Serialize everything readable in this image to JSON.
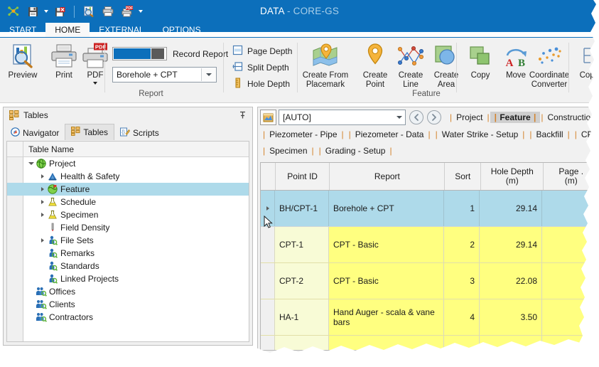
{
  "window": {
    "title_main": "DATA",
    "title_sep": " - ",
    "title_sub": "CORE-GS"
  },
  "quick_access": [
    {
      "name": "core-gs-logo-icon",
      "label": "CORE-GS"
    },
    {
      "name": "save-icon",
      "label": "Save"
    },
    {
      "name": "save-dropdown-caret-icon",
      "label": "Save options"
    },
    {
      "name": "save-close-icon",
      "label": "Save and Close"
    },
    {
      "name": "print-preview-icon",
      "label": "Print Preview"
    },
    {
      "name": "print-icon",
      "label": "Print"
    },
    {
      "name": "pdf-icon",
      "label": "PDF"
    },
    {
      "name": "pdf-dropdown-caret-icon",
      "label": "PDF options"
    }
  ],
  "ribbon_tabs": [
    {
      "label": "START",
      "active": false
    },
    {
      "label": "HOME",
      "active": true
    },
    {
      "label": "EXTERNAL",
      "active": false
    },
    {
      "label": "OPTIONS",
      "active": false
    }
  ],
  "ribbon": {
    "report_group": {
      "label": "Report",
      "preview": "Preview",
      "print": "Print",
      "pdf": "PDF",
      "record_report_label": "Record Report",
      "report_combo_value": "Borehole + CPT",
      "page_depth": "Page Depth",
      "split_depth": "Split Depth",
      "hole_depth": "Hole Depth"
    },
    "feature_group": {
      "label": "Feature",
      "create_from_placemark": "Create From\nPlacemark",
      "create_from_placemark_l1": "Create From",
      "create_from_placemark_l2": "Placemark",
      "create_point_l1": "Create",
      "create_point_l2": "Point",
      "create_line_l1": "Create",
      "create_line_l2": "Line",
      "create_area_l1": "Create",
      "create_area_l2": "Area",
      "copy": "Copy",
      "move": "Move",
      "coordinate_converter_l1": "Coordinate",
      "coordinate_converter_l2": "Converter"
    },
    "partial_group": {
      "copy_label": "Copy"
    }
  },
  "left_panel": {
    "header_title": "Tables",
    "pin_glyph": "∓",
    "tabs": [
      {
        "label": "Navigator",
        "icon": "compass-icon",
        "active": false
      },
      {
        "label": "Tables",
        "icon": "tables-icon",
        "active": true
      },
      {
        "label": "Scripts",
        "icon": "scripts-icon",
        "active": false
      }
    ],
    "column_header": "Table Name",
    "tree": [
      {
        "label": "Project",
        "indent": 0,
        "expander": "down",
        "icon": "globe-icon",
        "selected": false
      },
      {
        "label": "Health & Safety",
        "indent": 1,
        "expander": "right",
        "icon": "hardhat-icon",
        "selected": false
      },
      {
        "label": "Feature",
        "indent": 1,
        "expander": "right",
        "icon": "globe-flag-icon",
        "selected": true
      },
      {
        "label": "Schedule",
        "indent": 1,
        "expander": "right",
        "icon": "flask-icon",
        "selected": false
      },
      {
        "label": "Specimen",
        "indent": 1,
        "expander": "right",
        "icon": "flask-icon",
        "selected": false
      },
      {
        "label": "Field Density",
        "indent": 1,
        "expander": "none",
        "icon": "probe-icon",
        "selected": false
      },
      {
        "label": "File Sets",
        "indent": 1,
        "expander": "right",
        "icon": "person-icon",
        "selected": false
      },
      {
        "label": "Remarks",
        "indent": 1,
        "expander": "none",
        "icon": "person-icon",
        "selected": false
      },
      {
        "label": "Standards",
        "indent": 1,
        "expander": "none",
        "icon": "person-icon",
        "selected": false
      },
      {
        "label": "Linked Projects",
        "indent": 1,
        "expander": "none",
        "icon": "person-icon",
        "selected": false
      },
      {
        "label": "Offices",
        "indent": 0,
        "expander": "none",
        "icon": "people-icon",
        "selected": false
      },
      {
        "label": "Clients",
        "indent": 0,
        "expander": "none",
        "icon": "people-icon",
        "selected": false
      },
      {
        "label": "Contractors",
        "indent": 0,
        "expander": "none",
        "icon": "people-icon",
        "selected": false
      }
    ]
  },
  "right_panel": {
    "auto_icon": "table-select-icon",
    "auto_value": "[AUTO]",
    "nav_back": "back-arrow-icon",
    "nav_forward": "forward-arrow-icon",
    "tabs_row1": [
      {
        "label": "Project",
        "active": false
      },
      {
        "label": "Feature",
        "active": true
      },
      {
        "label": "Construction",
        "active": false
      }
    ],
    "tabs_row2": [
      {
        "label": "Piezometer - Pipe",
        "active": false
      },
      {
        "label": "Piezometer - Data",
        "active": false
      },
      {
        "label": "Water Strike - Setup",
        "active": false
      },
      {
        "label": "Backfill",
        "active": false
      },
      {
        "label": "CPT - Setup",
        "active": false
      }
    ],
    "tabs_row3": [
      {
        "label": "Specimen",
        "active": false
      },
      {
        "label": "Grading - Setup",
        "active": false
      }
    ],
    "grid": {
      "columns": [
        {
          "label": "Point ID",
          "sub": ""
        },
        {
          "label": "Report",
          "sub": ""
        },
        {
          "label": "Sort",
          "sub": ""
        },
        {
          "label": "Hole Depth",
          "sub": "(m)"
        },
        {
          "label": "Page .",
          "sub": "(m)"
        }
      ],
      "rows": [
        {
          "point_id": "BH/CPT-1",
          "report": "Borehole + CPT",
          "sort": "1",
          "hole_depth": "29.14",
          "page": "",
          "selected": true
        },
        {
          "point_id": "CPT-1",
          "report": "CPT - Basic",
          "sort": "2",
          "hole_depth": "29.14",
          "page": "",
          "selected": false
        },
        {
          "point_id": "CPT-2",
          "report": "CPT - Basic",
          "sort": "3",
          "hole_depth": "22.08",
          "page": "",
          "selected": false
        },
        {
          "point_id": "HA-1",
          "report": "Hand Auger - scala & vane bars",
          "sort": "4",
          "hole_depth": "3.50",
          "page": "",
          "selected": false
        }
      ]
    }
  },
  "colors": {
    "title_bar": "#0c6fbb",
    "accent": "#0c6fbb",
    "selection": "#aedaea",
    "row_yellow": "#ffff80",
    "row_yellow_light": "#f8fbd6",
    "tab_separator": "#d4822a",
    "ribbon_bg": "#f1f1f1"
  }
}
